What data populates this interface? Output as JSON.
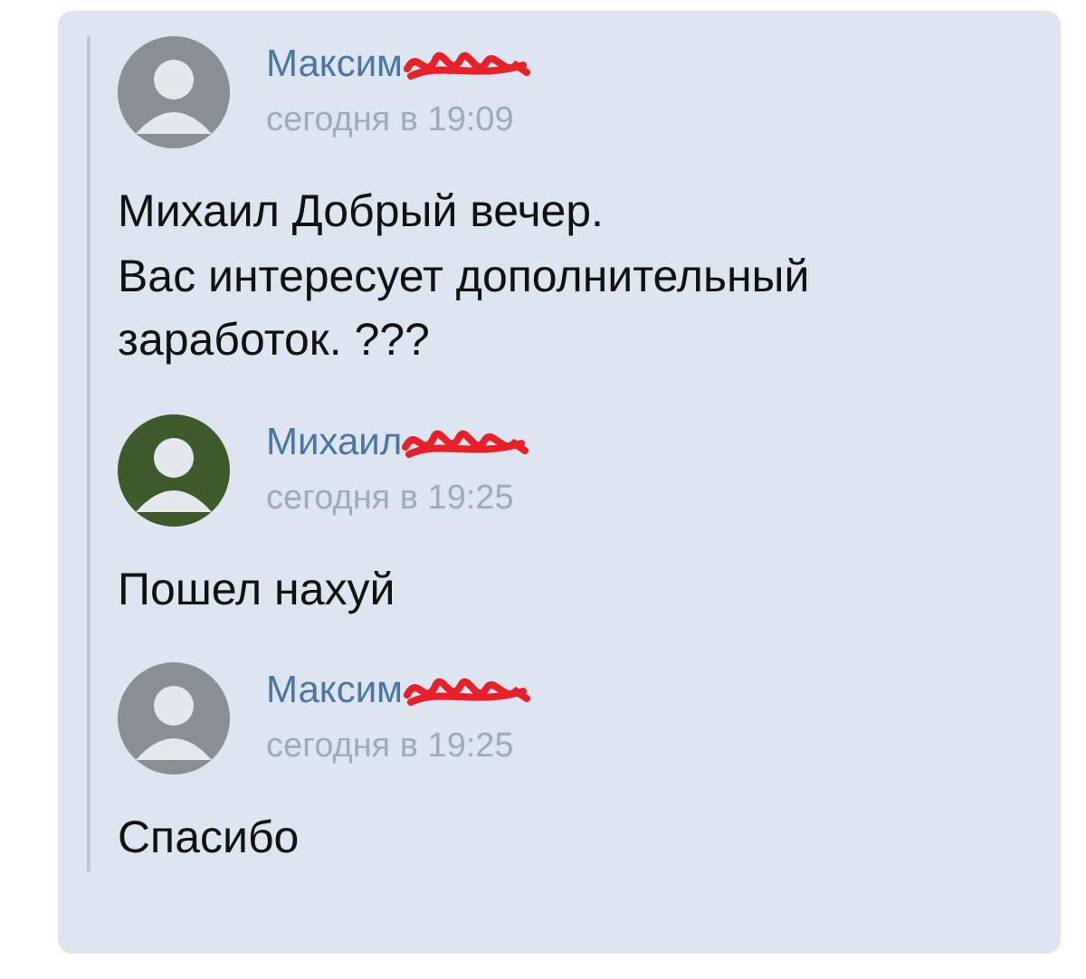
{
  "messages": [
    {
      "author": "Максим",
      "time": "сегодня в 19:09",
      "redacted": true,
      "color": "#8a8f96",
      "lines": [
        "Михаил Добрый вечер.",
        "Вас интересует дополнительный",
        "заработок. ???"
      ]
    },
    {
      "author": "Михаил",
      "time": "сегодня в 19:25",
      "redacted": true,
      "color": "#3d5a2a",
      "lines": [
        "Пошел нахуй"
      ]
    },
    {
      "author": "Максим",
      "time": "сегодня в 19:25",
      "redacted": true,
      "color": "#8a8f96",
      "lines": [
        "Спасибо"
      ]
    }
  ]
}
